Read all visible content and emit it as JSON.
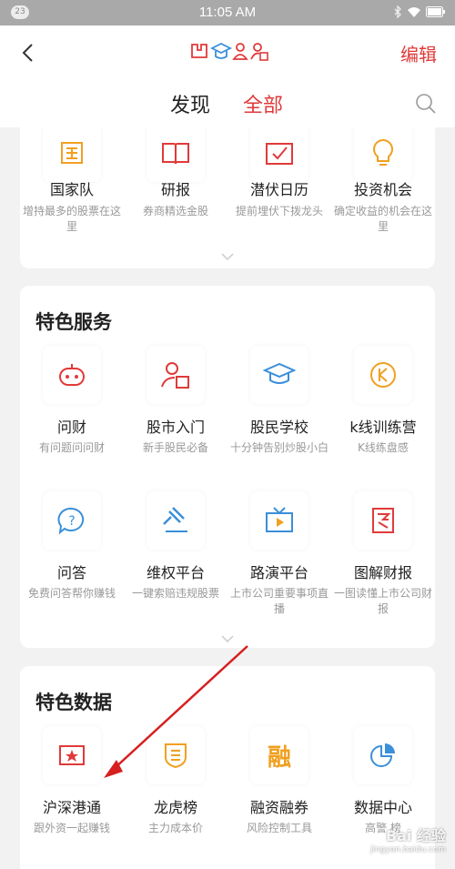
{
  "status_bar": {
    "badge": "23",
    "time": "11:05 AM"
  },
  "header": {
    "edit_label": "编辑"
  },
  "tabs": {
    "discover": "发现",
    "all": "全部"
  },
  "top_items": [
    {
      "label": "国家队",
      "desc": "增持最多的股票在这里"
    },
    {
      "label": "研报",
      "desc": "券商精选金股"
    },
    {
      "label": "潜伏日历",
      "desc": "提前埋伏下拨龙头"
    },
    {
      "label": "投资机会",
      "desc": "确定收益的机会在这里"
    }
  ],
  "special_services": {
    "title": "特色服务",
    "items": [
      {
        "label": "问财",
        "desc": "有问题问问财"
      },
      {
        "label": "股市入门",
        "desc": "新手股民必备"
      },
      {
        "label": "股民学校",
        "desc": "十分钟告别炒股小白"
      },
      {
        "label": "k线训练营",
        "desc": "K线练盘感"
      },
      {
        "label": "问答",
        "desc": "免费问答帮你赚钱"
      },
      {
        "label": "维权平台",
        "desc": "一键索赔违规股票"
      },
      {
        "label": "路演平台",
        "desc": "上市公司重要事项直播"
      },
      {
        "label": "图解财报",
        "desc": "一图读懂上市公司财报"
      }
    ]
  },
  "special_data": {
    "title": "特色数据",
    "items": [
      {
        "label": "沪深港通",
        "desc": "跟外资一起赚钱"
      },
      {
        "label": "龙虎榜",
        "desc": "主力成本价"
      },
      {
        "label": "融资融券",
        "desc": "风险控制工具"
      },
      {
        "label": "数据中心",
        "desc": "高警  榜"
      }
    ],
    "icon_char": "融"
  },
  "watermark": {
    "text": "Bai 经验",
    "url": "jingyan.baidu.com"
  },
  "colors": {
    "accent_red": "#e03a3a",
    "orange": "#f0a020",
    "blue": "#3a8fd9",
    "page_bg": "#f2f2f2"
  }
}
